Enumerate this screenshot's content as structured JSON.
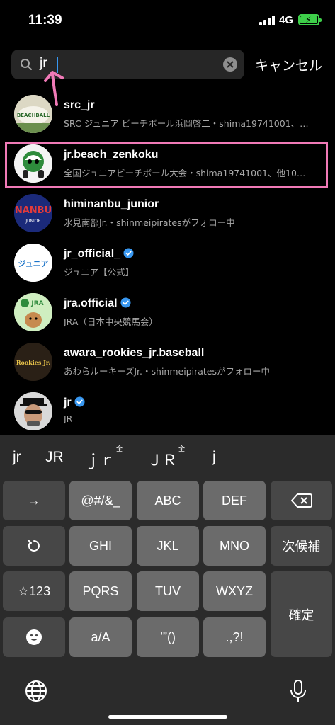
{
  "status_bar": {
    "time": "11:39",
    "network": "4G"
  },
  "search": {
    "query": "jr",
    "cancel_label": "キャンセル"
  },
  "results": [
    {
      "username": "src_jr",
      "subtitle": "SRC ジュニア ビーチボール浜岡啓二・shima19741001、…",
      "verified": false
    },
    {
      "username": "jr.beach_zenkoku",
      "subtitle": "全国ジュニアビーチボール大会・shima19741001、他10…",
      "verified": false
    },
    {
      "username": "himinanbu_junior",
      "subtitle": "氷見南部Jr.・shinmeipiratesがフォロー中",
      "verified": false
    },
    {
      "username": "jr_official_",
      "subtitle": "ジュニア【公式】",
      "verified": true
    },
    {
      "username": "jra.official",
      "subtitle": "JRA（日本中央競馬会）",
      "verified": true
    },
    {
      "username": "awara_rookies_jr.baseball",
      "subtitle": "あわらルーキーズJr.・shinmeipiratesがフォロー中",
      "verified": false
    },
    {
      "username": "jr",
      "subtitle": "JR",
      "verified": true
    }
  ],
  "avatar_text": {
    "src": "BEACHBALL",
    "himi": "NANBU",
    "himi_sub": "JUNIOR",
    "official": "ジュニア",
    "jra": "JRA",
    "awara": "Rookies Jr."
  },
  "keyboard": {
    "suggestions": [
      "jr",
      "JR",
      "ｊｒ",
      "ＪＲ",
      "j"
    ],
    "full_width_mark": "全",
    "keys": {
      "arrow": "→",
      "symbols": "@#/&_",
      "abc": "ABC",
      "def": "DEF",
      "ghi": "GHI",
      "jkl": "JKL",
      "mno": "MNO",
      "next": "次候補",
      "num": "☆123",
      "pqrs": "PQRS",
      "tuv": "TUV",
      "wxyz": "WXYZ",
      "confirm": "確定",
      "case": "a/A",
      "punct1": "’”()",
      "punct2": ".,?!"
    }
  },
  "colors": {
    "accent": "#3897f0",
    "highlight": "#f07ab7",
    "battery": "#3ecf4a"
  }
}
